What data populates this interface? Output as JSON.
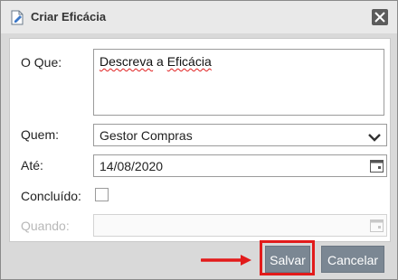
{
  "dialog": {
    "title": "Criar Eficácia",
    "close_icon": "close-icon",
    "title_icon": "document-edit-icon"
  },
  "form": {
    "o_que": {
      "label": "O Que:",
      "value_word1": "Descreva",
      "value_word2": "a",
      "value_word3": "Eficácia"
    },
    "quem": {
      "label": "Quem:",
      "value": "Gestor Compras"
    },
    "ate": {
      "label": "Até:",
      "value": "14/08/2020"
    },
    "concluido": {
      "label": "Concluído:",
      "checked": false
    },
    "quando": {
      "label": "Quando:",
      "value": "",
      "disabled": true
    }
  },
  "buttons": {
    "save": "Salvar",
    "cancel": "Cancelar"
  },
  "colors": {
    "button_bg": "#7b8793",
    "highlight": "#e21b1b",
    "annotation_arrow": "#e21b1b"
  }
}
